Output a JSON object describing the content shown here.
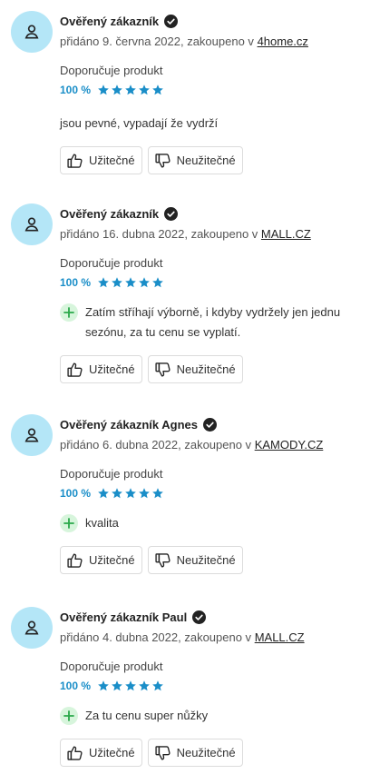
{
  "reviews": [
    {
      "author": "Ověřený zákazník",
      "meta_prefix": "přidáno 9. června 2022, zakoupeno v",
      "shop": "4home.cz",
      "recommend_label": "Doporučuje produkt",
      "percent": "100 %",
      "stars": 5,
      "text": "jsou pevné, vypadají že vydrží",
      "pros": [],
      "useful_label": "Užitečné",
      "useless_label": "Neužitečné"
    },
    {
      "author": "Ověřený zákazník",
      "meta_prefix": "přidáno 16. dubna 2022, zakoupeno v",
      "shop": "MALL.CZ",
      "recommend_label": "Doporučuje produkt",
      "percent": "100 %",
      "stars": 5,
      "text": "",
      "pros": [
        "Zatím stříhají výborně, i kdyby vydržely jen jednu sezónu, za tu cenu se vyplatí."
      ],
      "useful_label": "Užitečné",
      "useless_label": "Neužitečné"
    },
    {
      "author": "Ověřený zákazník Agnes",
      "meta_prefix": "přidáno 6. dubna 2022, zakoupeno v",
      "shop": "KAMODY.CZ",
      "recommend_label": "Doporučuje produkt",
      "percent": "100 %",
      "stars": 5,
      "text": "",
      "pros": [
        "kvalita"
      ],
      "useful_label": "Užitečné",
      "useless_label": "Neužitečné"
    },
    {
      "author": "Ověřený zákazník Paul",
      "meta_prefix": "přidáno 4. dubna 2022, zakoupeno v",
      "shop": "MALL.CZ",
      "recommend_label": "Doporučuje produkt",
      "percent": "100 %",
      "stars": 5,
      "text": "",
      "pros": [
        "Za tu cenu super nůžky"
      ],
      "useful_label": "Užitečné",
      "useless_label": "Neužitečné"
    }
  ],
  "colors": {
    "avatar_bg": "#b4e6f7",
    "star": "#1a8ec8",
    "percent": "#1a8ec8",
    "pro_badge_bg": "#d7f5dc",
    "pro_plus": "#2aa84a"
  },
  "icons": {
    "avatar": "user-icon",
    "verified": "check-circle-icon",
    "star": "star-icon",
    "pro": "plus-icon",
    "useful": "thumbs-up-icon",
    "useless": "thumbs-down-icon"
  }
}
